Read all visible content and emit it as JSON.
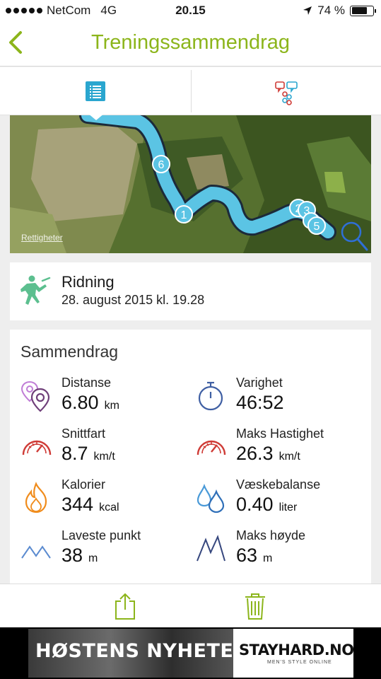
{
  "status_bar": {
    "carrier": "NetCom",
    "network": "4G",
    "time": "20.15",
    "battery": "74 %",
    "battery_level": 0.74
  },
  "nav": {
    "title": "Treningssammendrag"
  },
  "tabs": [
    {
      "icon": "list-icon",
      "selected": true
    },
    {
      "icon": "split-details-icon",
      "selected": false
    }
  ],
  "map": {
    "credit": "Rettigheter",
    "markers": [
      "1",
      "2",
      "3",
      "5",
      "6"
    ]
  },
  "activity": {
    "name": "Ridning",
    "date": "28. august 2015 kl. 19.28",
    "icon": "horse-riding-icon"
  },
  "summary": {
    "title": "Sammendrag",
    "stats": [
      {
        "label": "Distanse",
        "value": "6.80",
        "unit": "km",
        "icon": "distance-pin-icon"
      },
      {
        "label": "Varighet",
        "value": "46:52",
        "unit": "",
        "icon": "stopwatch-icon"
      },
      {
        "label": "Snittfart",
        "value": "8.7",
        "unit": "km/t",
        "icon": "speedometer-icon"
      },
      {
        "label": "Maks Hastighet",
        "value": "26.3",
        "unit": "km/t",
        "icon": "speedometer-icon"
      },
      {
        "label": "Kalorier",
        "value": "344",
        "unit": "kcal",
        "icon": "flame-icon"
      },
      {
        "label": "Væskebalanse",
        "value": "0.40",
        "unit": "liter",
        "icon": "water-drops-icon"
      },
      {
        "label": "Laveste punkt",
        "value": "38",
        "unit": "m",
        "icon": "low-mountain-icon"
      },
      {
        "label": "Maks høyde",
        "value": "63",
        "unit": "m",
        "icon": "high-mountain-icon"
      }
    ]
  },
  "toolbar": {
    "share_icon": "share-icon",
    "delete_icon": "trash-icon"
  },
  "ad": {
    "headline": "HØSTENS NYHETER",
    "brand": "STAYHARD.NO",
    "tagline": "MEN'S STYLE ONLINE"
  },
  "colors": {
    "accent_green": "#8cb51b",
    "route_blue": "#5bc4e4",
    "icon_purple": "#6f3f79",
    "icon_blue": "#3f5fa3",
    "icon_red": "#cf3b36",
    "icon_orange": "#f08c1c"
  }
}
